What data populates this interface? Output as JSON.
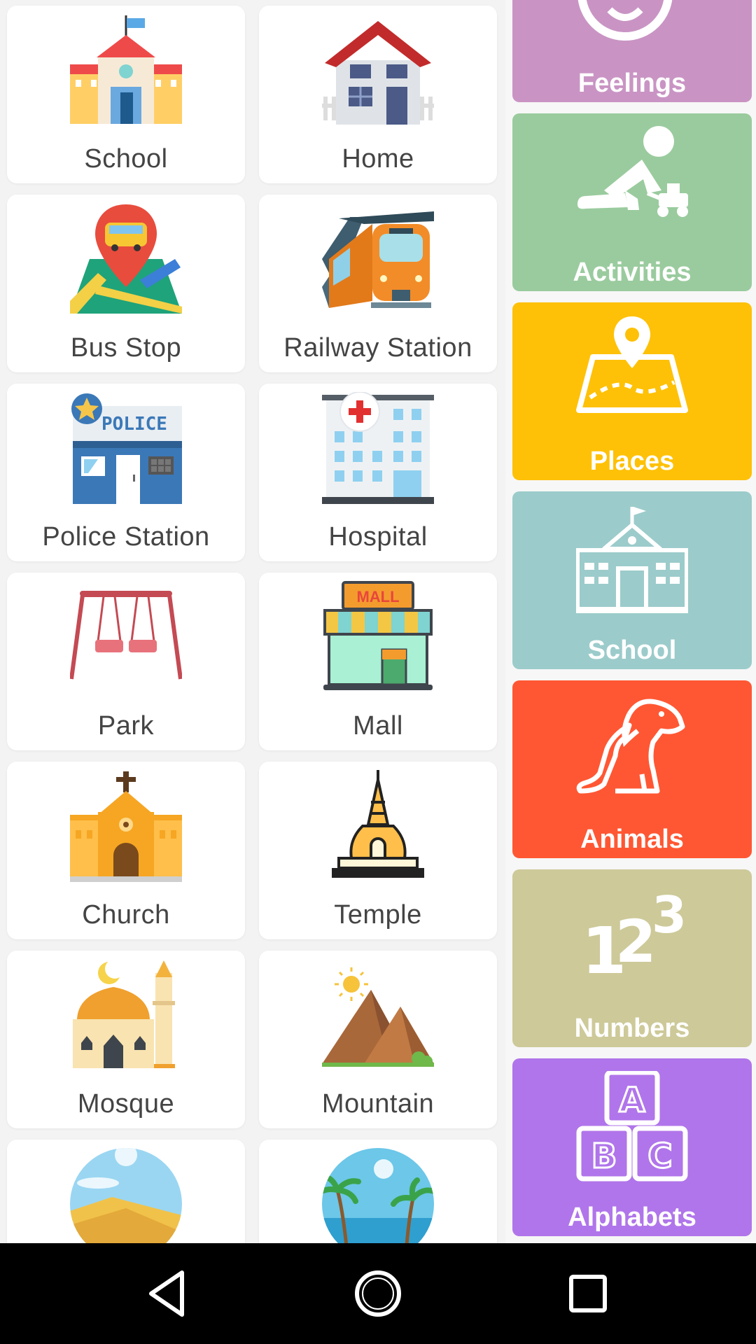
{
  "places": [
    {
      "label": "School",
      "icon": "school-building-icon"
    },
    {
      "label": "Home",
      "icon": "house-icon"
    },
    {
      "label": "Bus Stop",
      "icon": "bus-map-pin-icon"
    },
    {
      "label": "Railway Station",
      "icon": "train-icon"
    },
    {
      "label": "Police Station",
      "icon": "police-building-icon"
    },
    {
      "label": "Hospital",
      "icon": "hospital-icon"
    },
    {
      "label": "Park",
      "icon": "swing-icon"
    },
    {
      "label": "Mall",
      "icon": "mall-icon",
      "sign": "MALL"
    },
    {
      "label": "Church",
      "icon": "church-icon"
    },
    {
      "label": "Temple",
      "icon": "temple-icon"
    },
    {
      "label": "Mosque",
      "icon": "mosque-icon"
    },
    {
      "label": "Mountain",
      "icon": "mountain-icon"
    },
    {
      "label": "",
      "icon": "desert-icon"
    },
    {
      "label": "",
      "icon": "beach-icon"
    }
  ],
  "police_sign": "POLICE",
  "categories": [
    {
      "label": "Feelings",
      "icon": "face-icon",
      "color": "#c994c4"
    },
    {
      "label": "Activities",
      "icon": "child-playing-icon",
      "color": "#9acb9e"
    },
    {
      "label": "Places",
      "icon": "map-pin-icon",
      "color": "#fec107"
    },
    {
      "label": "School",
      "icon": "school-outline-icon",
      "color": "#9ccbcb"
    },
    {
      "label": "Animals",
      "icon": "dog-icon",
      "color": "#ff5733"
    },
    {
      "label": "Numbers",
      "icon": "numbers-icon",
      "color": "#cdc999",
      "digits": [
        "1",
        "2",
        "3"
      ]
    },
    {
      "label": "Alphabets",
      "icon": "alphabet-blocks-icon",
      "color": "#b075ea",
      "letters": [
        "A",
        "B",
        "C"
      ]
    }
  ],
  "navigation": {
    "back": "back-icon",
    "home": "home-circle-icon",
    "recents": "recents-icon"
  }
}
